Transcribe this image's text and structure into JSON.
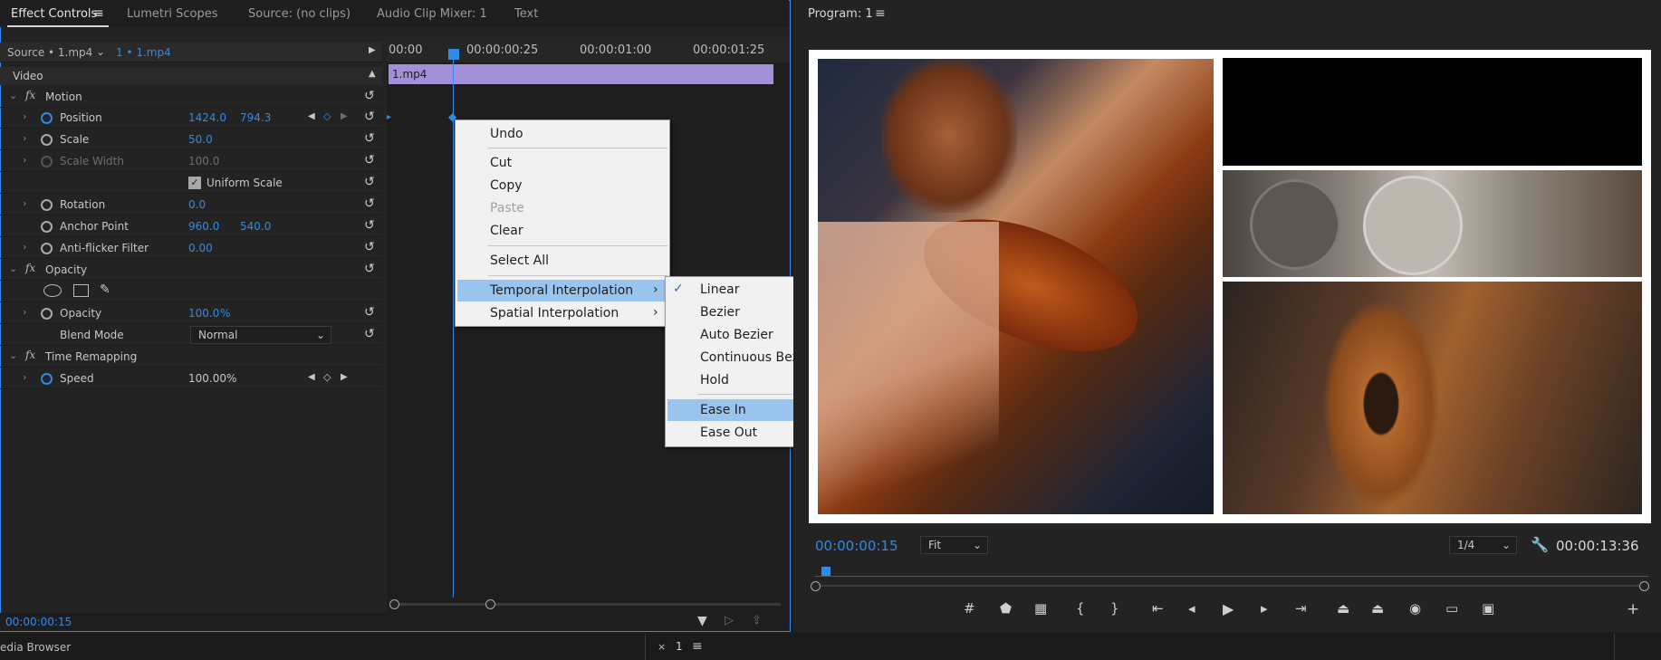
{
  "colors": {
    "accent": "#2d8ceb",
    "clip": "#a48fd8",
    "menu_highlight": "#98c4ed"
  },
  "ec_tabs": [
    {
      "label": "Effect Controls",
      "active": true
    },
    {
      "label": "Lumetri Scopes"
    },
    {
      "label": "Source: (no clips)"
    },
    {
      "label": "Audio Clip Mixer: 1"
    },
    {
      "label": "Text"
    }
  ],
  "source": {
    "master": "Source • 1.mp4",
    "sequence": "1 • 1.mp4"
  },
  "ruler": [
    "00:00",
    "00:00:00:25",
    "00:00:01:00",
    "00:00:01:25"
  ],
  "clip_label": "1.mp4",
  "section_video": "Video",
  "motion": {
    "header": "Motion",
    "position": {
      "label": "Position",
      "x": "1424.0",
      "y": "794.3"
    },
    "scale": {
      "label": "Scale",
      "value": "50.0"
    },
    "scale_width": {
      "label": "Scale Width",
      "value": "100.0"
    },
    "uniform_scale": "Uniform Scale",
    "rotation": {
      "label": "Rotation",
      "value": "0.0"
    },
    "anchor": {
      "label": "Anchor Point",
      "x": "960.0",
      "y": "540.0"
    },
    "antiflicker": {
      "label": "Anti-flicker Filter",
      "value": "0.00"
    }
  },
  "opacity": {
    "header": "Opacity",
    "label": "Opacity",
    "value": "100.0",
    "unit": "%",
    "blend_label": "Blend Mode",
    "blend_value": "Normal"
  },
  "time_remap": {
    "header": "Time Remapping",
    "speed_label": "Speed",
    "speed_value": "100.00%"
  },
  "ec_timecode": "00:00:00:15",
  "context_menu": {
    "items": [
      "Undo",
      "Cut",
      "Copy",
      "Paste",
      "Clear",
      "Select All",
      "Temporal Interpolation",
      "Spatial Interpolation"
    ],
    "disabled": [
      "Paste"
    ]
  },
  "submenu": {
    "items": [
      "Linear",
      "Bezier",
      "Auto Bezier",
      "Continuous Bezier",
      "Hold",
      "Ease In",
      "Ease Out"
    ],
    "checked": "Linear",
    "highlighted": "Ease In"
  },
  "program": {
    "title": "Program: 1",
    "timecode": "00:00:00:15",
    "fit": "Fit",
    "resolution": "1/4",
    "duration": "00:00:13:36"
  },
  "bottom": {
    "media_browser": "edia Browser",
    "seq_tab": "1"
  }
}
